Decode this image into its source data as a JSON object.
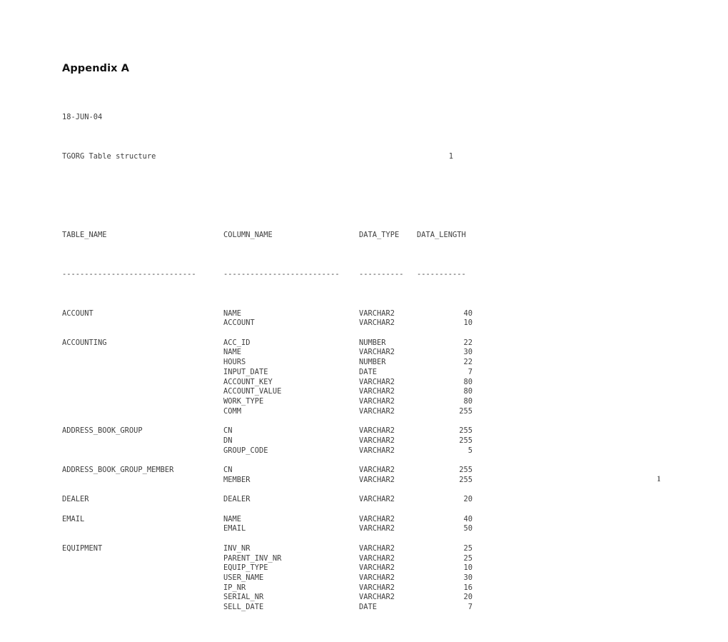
{
  "document": {
    "appendix_title": "Appendix A",
    "footer_page_number": "1"
  },
  "report": {
    "date": "18-JUN-04",
    "subject": "TGORG Table structure",
    "page_number": "1",
    "headers": {
      "table_name": "TABLE_NAME",
      "column_name": "COLUMN_NAME",
      "data_type": "DATA_TYPE",
      "data_length": "DATA_LENGTH"
    },
    "separators": {
      "table_name": "------------------------------",
      "column_name": "--------------------------",
      "data_type": "----------",
      "data_length": "-----------"
    },
    "rows": [
      {
        "table": "ACCOUNT",
        "column": "NAME",
        "type": "VARCHAR2",
        "length": "40"
      },
      {
        "table": "",
        "column": "ACCOUNT",
        "type": "VARCHAR2",
        "length": "10"
      },
      {
        "table": "",
        "column": "",
        "type": "",
        "length": ""
      },
      {
        "table": "ACCOUNTING",
        "column": "ACC_ID",
        "type": "NUMBER",
        "length": "22"
      },
      {
        "table": "",
        "column": "NAME",
        "type": "VARCHAR2",
        "length": "30"
      },
      {
        "table": "",
        "column": "HOURS",
        "type": "NUMBER",
        "length": "22"
      },
      {
        "table": "",
        "column": "INPUT_DATE",
        "type": "DATE",
        "length": "7"
      },
      {
        "table": "",
        "column": "ACCOUNT_KEY",
        "type": "VARCHAR2",
        "length": "80"
      },
      {
        "table": "",
        "column": "ACCOUNT_VALUE",
        "type": "VARCHAR2",
        "length": "80"
      },
      {
        "table": "",
        "column": "WORK_TYPE",
        "type": "VARCHAR2",
        "length": "80"
      },
      {
        "table": "",
        "column": "COMM",
        "type": "VARCHAR2",
        "length": "255"
      },
      {
        "table": "",
        "column": "",
        "type": "",
        "length": ""
      },
      {
        "table": "ADDRESS_BOOK_GROUP",
        "column": "CN",
        "type": "VARCHAR2",
        "length": "255"
      },
      {
        "table": "",
        "column": "DN",
        "type": "VARCHAR2",
        "length": "255"
      },
      {
        "table": "",
        "column": "GROUP_CODE",
        "type": "VARCHAR2",
        "length": "5"
      },
      {
        "table": "",
        "column": "",
        "type": "",
        "length": ""
      },
      {
        "table": "ADDRESS_BOOK_GROUP_MEMBER",
        "column": "CN",
        "type": "VARCHAR2",
        "length": "255"
      },
      {
        "table": "",
        "column": "MEMBER",
        "type": "VARCHAR2",
        "length": "255"
      },
      {
        "table": "",
        "column": "",
        "type": "",
        "length": ""
      },
      {
        "table": "DEALER",
        "column": "DEALER",
        "type": "VARCHAR2",
        "length": "20"
      },
      {
        "table": "",
        "column": "",
        "type": "",
        "length": ""
      },
      {
        "table": "EMAIL",
        "column": "NAME",
        "type": "VARCHAR2",
        "length": "40"
      },
      {
        "table": "",
        "column": "EMAIL",
        "type": "VARCHAR2",
        "length": "50"
      },
      {
        "table": "",
        "column": "",
        "type": "",
        "length": ""
      },
      {
        "table": "EQUIPMENT",
        "column": "INV_NR",
        "type": "VARCHAR2",
        "length": "25"
      },
      {
        "table": "",
        "column": "PARENT_INV_NR",
        "type": "VARCHAR2",
        "length": "25"
      },
      {
        "table": "",
        "column": "EQUIP_TYPE",
        "type": "VARCHAR2",
        "length": "10"
      },
      {
        "table": "",
        "column": "USER_NAME",
        "type": "VARCHAR2",
        "length": "30"
      },
      {
        "table": "",
        "column": "IP_NR",
        "type": "VARCHAR2",
        "length": "16"
      },
      {
        "table": "",
        "column": "SERIAL_NR",
        "type": "VARCHAR2",
        "length": "20"
      },
      {
        "table": "",
        "column": "SELL_DATE",
        "type": "DATE",
        "length": "7"
      }
    ]
  }
}
